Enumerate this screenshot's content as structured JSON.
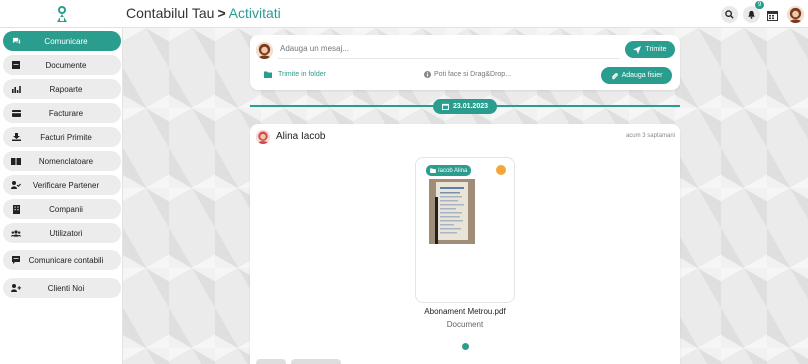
{
  "header": {
    "breadcrumb_root": "Contabilul Tau",
    "breadcrumb_separator": ">",
    "breadcrumb_current": "Activitati",
    "notification_badge": "9",
    "icons": [
      "logo-icon",
      "search-icon",
      "bell-icon",
      "calendar-icon",
      "user-avatar"
    ]
  },
  "sidebar": {
    "items": [
      {
        "label": "Comunicare",
        "icon": "chat-icon",
        "active": true
      },
      {
        "label": "Documente",
        "icon": "document-icon",
        "active": false
      },
      {
        "label": "Rapoarte",
        "icon": "chart-icon",
        "active": false
      },
      {
        "label": "Facturare",
        "icon": "card-icon",
        "active": false
      },
      {
        "label": "Facturi Primite",
        "icon": "inbox-icon",
        "active": false
      },
      {
        "label": "Nomenclatoare",
        "icon": "book-icon",
        "active": false
      },
      {
        "label": "Verificare Partener",
        "icon": "user-check-icon",
        "active": false
      },
      {
        "label": "Companii",
        "icon": "building-icon",
        "active": false
      },
      {
        "label": "Utilizatori",
        "icon": "users-icon",
        "active": false
      },
      {
        "label": "Comunicare contabili",
        "icon": "message-icon",
        "active": false
      },
      {
        "label": "Clienti Noi",
        "icon": "user-plus-icon",
        "active": false
      }
    ]
  },
  "composer": {
    "placeholder": "Adauga un mesaj...",
    "send_label": "Trimite",
    "folder_label": "Trimite in folder",
    "drag_hint": "Poti face si Drag&Drop...",
    "attach_label": "Adauga fisier"
  },
  "date_separator": "23.01.2023",
  "post": {
    "author": "Alina Iacob",
    "time": "acum 3 saptamani",
    "document": {
      "tag": "Iacob Alina",
      "name": "Abonament Metrou.pdf",
      "type": "Document"
    }
  },
  "colors": {
    "accent": "#2a9d8f",
    "status_dot": "#f3a73a",
    "sidebar_item_bg": "#ececec"
  }
}
